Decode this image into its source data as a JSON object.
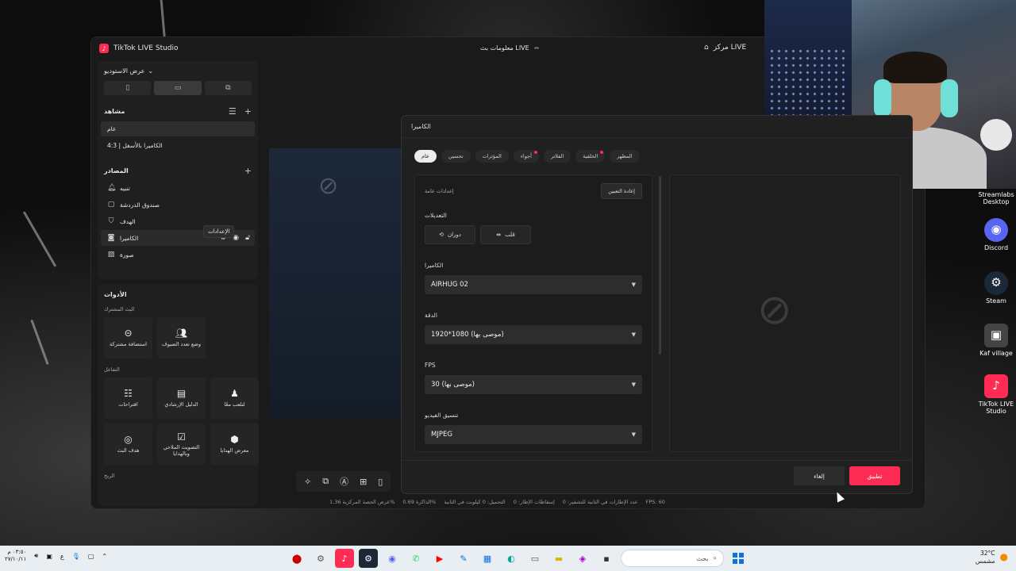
{
  "app": {
    "title": "TikTok LIVE Studio",
    "center_title": "معلومات بث LIVE",
    "right_title": "مركز LIVE"
  },
  "left": {
    "studio_view": "عرض الاستوديو",
    "scenes_title": "مشاهد",
    "scenes": [
      "عام",
      "الكاميرا بالأسفل | 4:3"
    ],
    "sources_title": "المصادر",
    "sources": [
      {
        "label": "تنبيه",
        "icon": "bell-icon"
      },
      {
        "label": "صندوق الدردشة",
        "icon": "chat-icon"
      },
      {
        "label": "الهدف",
        "icon": "shield-icon"
      },
      {
        "label": "الكاميرا",
        "icon": "camera-icon"
      },
      {
        "label": "صورة",
        "icon": "image-icon"
      }
    ],
    "tooltip": "الإعدادات",
    "tools_title": "الأدوات",
    "shared_title": "البث المشترك",
    "shared": [
      "استضافة مشتركة",
      "وضع تعدد الضيوف"
    ],
    "interaction_title": "التفاعل",
    "interaction": [
      "اقتراحات",
      "الدليل الإرشادي",
      "لتلعب معًا"
    ],
    "interaction2": [
      "هدف البث",
      "التصويت الملاحي وبالهدايا",
      "معرض الهدايا"
    ],
    "profit_title": "الربح"
  },
  "status": {
    "items": [
      "عرض الحصة المركزية 1.36%",
      "الذاكرة 0.69%",
      "التحميل: 0 كيلوبت في الثانية",
      "إسقاطات الإطار: 0",
      "عدد الإطارات في الثانية للتشفير: 0",
      "FPS: 60"
    ]
  },
  "dialog": {
    "title": "الكاميرا",
    "tabs": [
      "عام",
      "تحسين",
      "المؤثرات",
      "أجواء",
      "الفلاتر",
      "الخلفية",
      "المظهر"
    ],
    "general_settings": "إعدادات عامة",
    "reset": "إعادة التعيين",
    "adjustments_label": "التعديلات",
    "rotate": "دوران",
    "flip": "قلب",
    "camera_label": "الكاميرا",
    "camera_value": "AIRHUG 02",
    "resolution_label": "الدقة",
    "resolution_value": "1920*1080 (موصى بها)",
    "fps_label": "FPS",
    "fps_value": "30 (موصى بها)",
    "format_label": "تنسيق الفيديو",
    "format_value": "MJPEG",
    "cancel": "إلغاء",
    "apply": "تطبيق"
  },
  "desktop": {
    "icons": [
      "Streamlabs Desktop",
      "Discord",
      "Steam",
      "Kaf village",
      "TikTok LIVE Studio"
    ]
  },
  "taskbar": {
    "time": "٠٣:٥٠ م",
    "date": "٢٧/١٠/١١",
    "lang": "ع",
    "search": "بحث",
    "temp": "32°C",
    "weather": "مشمس"
  }
}
